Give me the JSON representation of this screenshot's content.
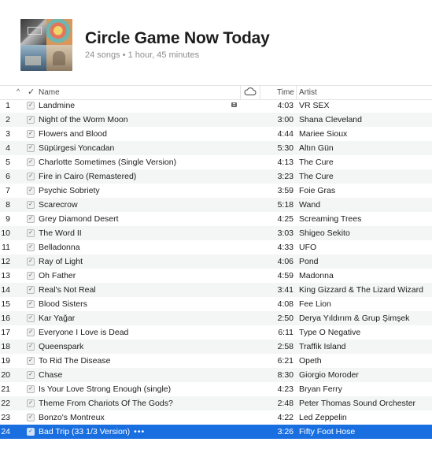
{
  "playlist": {
    "title": "Circle Game Now Today",
    "subtitle": "24 songs • 1 hour, 45 minutes"
  },
  "columns": {
    "sort_indicator": "^",
    "check": "✓",
    "name": "Name",
    "cloud_icon": "cloud-icon",
    "time": "Time",
    "artist": "Artist"
  },
  "tracks": [
    {
      "num": "1",
      "name": "Landmine",
      "time": "4:03",
      "artist": "VR SEX",
      "badge": true
    },
    {
      "num": "2",
      "name": "Night of the Worm Moon",
      "time": "3:00",
      "artist": "Shana Cleveland"
    },
    {
      "num": "3",
      "name": "Flowers and Blood",
      "time": "4:44",
      "artist": "Mariee Sioux"
    },
    {
      "num": "4",
      "name": "Süpürgesi Yoncadan",
      "time": "5:30",
      "artist": "Altın Gün"
    },
    {
      "num": "5",
      "name": "Charlotte Sometimes (Single Version)",
      "time": "4:13",
      "artist": "The Cure"
    },
    {
      "num": "6",
      "name": "Fire in Cairo (Remastered)",
      "time": "3:23",
      "artist": "The Cure"
    },
    {
      "num": "7",
      "name": "Psychic Sobriety",
      "time": "3:59",
      "artist": "Foie Gras"
    },
    {
      "num": "8",
      "name": "Scarecrow",
      "time": "5:18",
      "artist": "Wand"
    },
    {
      "num": "9",
      "name": "Grey Diamond Desert",
      "time": "4:25",
      "artist": "Screaming Trees"
    },
    {
      "num": "10",
      "name": "The Word II",
      "time": "3:03",
      "artist": "Shigeo Sekito"
    },
    {
      "num": "11",
      "name": "Belladonna",
      "time": "4:33",
      "artist": "UFO"
    },
    {
      "num": "12",
      "name": "Ray of Light",
      "time": "4:06",
      "artist": "Pond"
    },
    {
      "num": "13",
      "name": "Oh Father",
      "time": "4:59",
      "artist": "Madonna"
    },
    {
      "num": "14",
      "name": "Real's Not Real",
      "time": "3:41",
      "artist": "King Gizzard & The Lizard Wizard"
    },
    {
      "num": "15",
      "name": "Blood Sisters",
      "time": "4:08",
      "artist": "Fee Lion"
    },
    {
      "num": "16",
      "name": "Kar Yağar",
      "time": "2:50",
      "artist": "Derya Yıldırım & Grup Şimşek"
    },
    {
      "num": "17",
      "name": "Everyone I Love is Dead",
      "time": "6:11",
      "artist": "Type O Negative"
    },
    {
      "num": "18",
      "name": "Queenspark",
      "time": "2:58",
      "artist": "Traffik Island"
    },
    {
      "num": "19",
      "name": "To Rid The Disease",
      "time": "6:21",
      "artist": "Opeth"
    },
    {
      "num": "20",
      "name": "Chase",
      "time": "8:30",
      "artist": "Giorgio Moroder"
    },
    {
      "num": "21",
      "name": "Is Your Love Strong Enough (single)",
      "time": "4:23",
      "artist": "Bryan Ferry"
    },
    {
      "num": "22",
      "name": "Theme From Chariots Of The Gods?",
      "time": "2:48",
      "artist": "Peter Thomas Sound Orchester"
    },
    {
      "num": "23",
      "name": "Bonzo's Montreux",
      "time": "4:22",
      "artist": "Led Zeppelin"
    },
    {
      "num": "24",
      "name": "Bad Trip (33 1/3 Version)",
      "time": "3:26",
      "artist": "Fifty Foot Hose",
      "selected": true,
      "more": "•••"
    }
  ],
  "colors": {
    "selection": "#1a6fe0",
    "alt_row": "#f4f5f5"
  }
}
